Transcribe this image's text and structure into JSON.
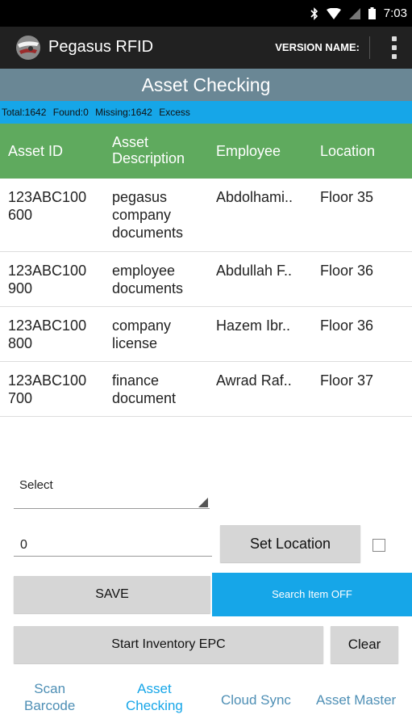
{
  "status_bar": {
    "time": "7:03"
  },
  "app_bar": {
    "title": "Pegasus RFID",
    "version_label": "VERSION NAME:"
  },
  "screen": {
    "title": "Asset Checking"
  },
  "counts": {
    "total": "Total:1642",
    "found": "Found:0",
    "missing": "Missing:1642",
    "excess": "Excess"
  },
  "table": {
    "headers": {
      "asset_id": "Asset ID",
      "description_line1": "Asset",
      "description_line2": "Description",
      "employee": "Employee",
      "location": "Location"
    },
    "rows": [
      {
        "id_line1": "123ABC100",
        "id_line2": "600",
        "desc_line1": "pegasus",
        "desc_line2": "company",
        "desc_line3": "documents",
        "employee": "Abdolhami..",
        "location": "Floor 35"
      },
      {
        "id_line1": "123ABC100",
        "id_line2": "900",
        "desc_line1": "employee",
        "desc_line2": "documents",
        "employee": "Abdullah F..",
        "location": "Floor 36"
      },
      {
        "id_line1": "123ABC100",
        "id_line2": "800",
        "desc_line1": "company",
        "desc_line2": "license",
        "employee": "Hazem Ibr..",
        "location": "Floor 36"
      },
      {
        "id_line1": "123ABC100",
        "id_line2": "700",
        "desc_line1": "finance",
        "desc_line2": "document",
        "employee": "Awrad Raf..",
        "location": "Floor 37"
      }
    ]
  },
  "controls": {
    "select_label": "Select",
    "quantity_value": "0",
    "set_location_label": "Set Location",
    "save_label": "SAVE",
    "search_item_label": "Search Item OFF",
    "start_inventory_label": "Start Inventory EPC",
    "clear_label": "Clear"
  },
  "bottom_nav": {
    "scan_line1": "Scan",
    "scan_line2": "Barcode",
    "asset_line1": "Asset",
    "asset_line2": "Checking",
    "cloud_sync": "Cloud Sync",
    "asset_master": "Asset Master"
  },
  "colors": {
    "title_banner": "#6a8795",
    "count_bar": "#16a6e8",
    "table_header": "#5faa5e",
    "accent": "#16a6e8"
  }
}
